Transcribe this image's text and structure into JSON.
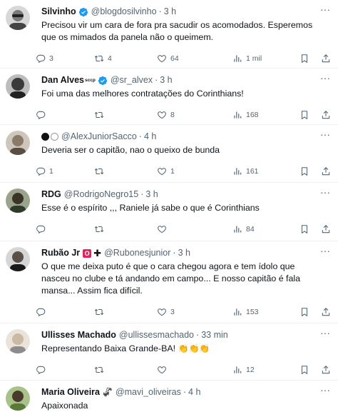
{
  "tweets": [
    {
      "name": "Silvinho",
      "verified": true,
      "handle": "@blogdosilvinho",
      "time": "3 h",
      "text": "Precisou vir um cara de fora pra sacudir os acomodados. Esperemos que os mimados da panela não o queimem.",
      "replies": "3",
      "retweets": "4",
      "likes": "64",
      "views": "1 mil",
      "avatar_color": "#6b6b6b"
    },
    {
      "name": "Dan Alves",
      "name_suffix": "sccp",
      "verified": true,
      "handle": "@sr_alvex",
      "time": "3 h",
      "text": "Foi uma das melhores contratações do Corinthians!",
      "replies": "",
      "retweets": "",
      "likes": "8",
      "views": "168",
      "avatar_color": "#3a3a3a"
    },
    {
      "name": "",
      "verified": false,
      "handle": "@AlexJuniorSacco",
      "time": "4 h",
      "text": "Deveria ser o capitão, nao o queixo de bunda",
      "replies": "1",
      "retweets": "",
      "likes": "1",
      "views": "161",
      "avatar_color": "#8a7a6a"
    },
    {
      "name": "RDG",
      "verified": false,
      "handle": "@RodrigoNegro15",
      "time": "3 h",
      "text": "Esse é o espírito ,,, Raniele já sabe o que é Corinthians",
      "replies": "",
      "retweets": "",
      "likes": "",
      "views": "84",
      "avatar_color": "#2f3b2a"
    },
    {
      "name": "Rubão Jr",
      "verified": false,
      "handle": "@Rubonesjunior",
      "time": "3 h",
      "text": "O que me deixa puto é que o cara chegou agora e tem ídolo que nasceu no clube e tá andando em campo... E nosso capitão é fala mansa... Assim fica difícil.",
      "replies": "",
      "retweets": "",
      "likes": "3",
      "views": "153",
      "avatar_color": "#1a1a1a"
    },
    {
      "name": "Ullisses Machado",
      "verified": false,
      "handle": "@ullissesmachado",
      "time": "33 min",
      "text": "Representando Baixa Grande-BA!",
      "text_emoji": "👏👏👏",
      "replies": "",
      "retweets": "",
      "likes": "",
      "views": "12",
      "avatar_color": "#c9b9a5"
    },
    {
      "name": "Maria Oliveira",
      "verified": false,
      "handle": "@mavi_oliveiras",
      "time": "4 h",
      "text": "Apaixonada",
      "avatar_color": "#5a7a3a"
    }
  ],
  "icons": {
    "reply": "reply-icon",
    "retweet": "retweet-icon",
    "like": "heart-icon",
    "views": "views-icon",
    "bookmark": "bookmark-icon",
    "share": "share-icon",
    "verified": "verified-badge-icon",
    "more": "more-icon"
  },
  "colors": {
    "text": "#0f1419",
    "secondary": "#536471",
    "verified": "#1d9bf0",
    "divider": "#eff3f4"
  }
}
